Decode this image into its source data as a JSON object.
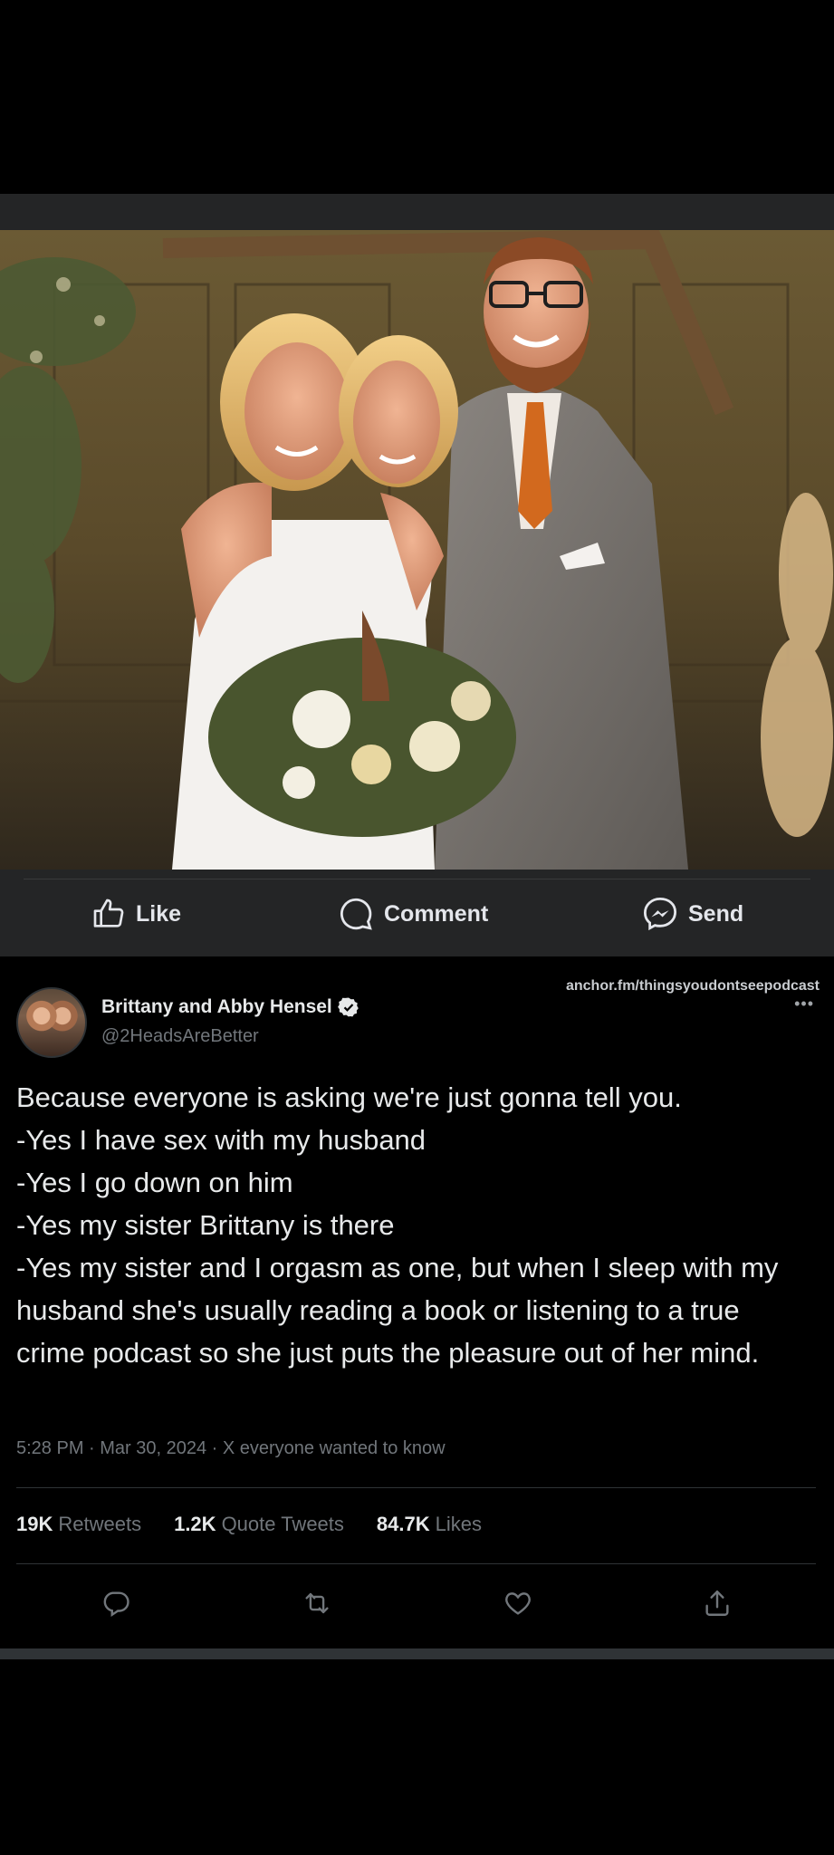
{
  "facebook_card": {
    "photo_alt": "",
    "actions": {
      "like_label": "Like",
      "comment_label": "Comment",
      "send_label": "Send"
    }
  },
  "tweet": {
    "watermark": "anchor.fm/thingsyoudontseepodcast",
    "more_label": "•••",
    "author": {
      "display_name": "Brittany and Abby Hensel",
      "handle": "@2HeadsAreBetter",
      "verified": true
    },
    "text": "Because everyone is asking we're just gonna tell you.\n-Yes I have sex with my husband\n-Yes I go down on him\n-Yes my sister Brittany is there\n-Yes my sister and I orgasm as one, but when I sleep with my husband she's usually reading a book or listening to a true crime podcast so she just puts the pleasure out of her mind.",
    "meta": "5:28 PM · Mar 30, 2024 · X everyone wanted to know",
    "stats": [
      {
        "number": "19K",
        "label": "Retweets"
      },
      {
        "number": "1.2K",
        "label": "Quote Tweets"
      },
      {
        "number": "84.7K",
        "label": "Likes"
      }
    ],
    "action_icons": [
      "reply-icon",
      "retweet-icon",
      "like-icon",
      "share-icon"
    ]
  },
  "colors": {
    "facebook_bar": "#242526",
    "twitter_bg": "#000000",
    "muted_text": "#71767b",
    "text": "#e7e9ea",
    "tie_orange": "#d2691e"
  }
}
